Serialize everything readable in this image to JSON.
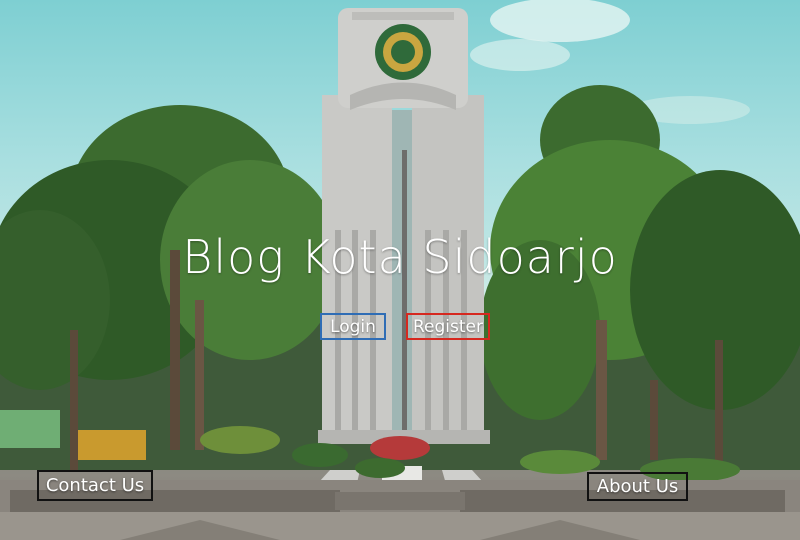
{
  "hero": {
    "title": "Blog Kota Sidoarjo"
  },
  "auth": {
    "login_label": "Login",
    "register_label": "Register"
  },
  "footer_nav": {
    "contact_label": "Contact Us",
    "about_label": "About Us"
  },
  "colors": {
    "login_border": "#2f6db5",
    "register_border": "#d6281f",
    "nav_border": "#111111",
    "text": "#ffffff"
  }
}
